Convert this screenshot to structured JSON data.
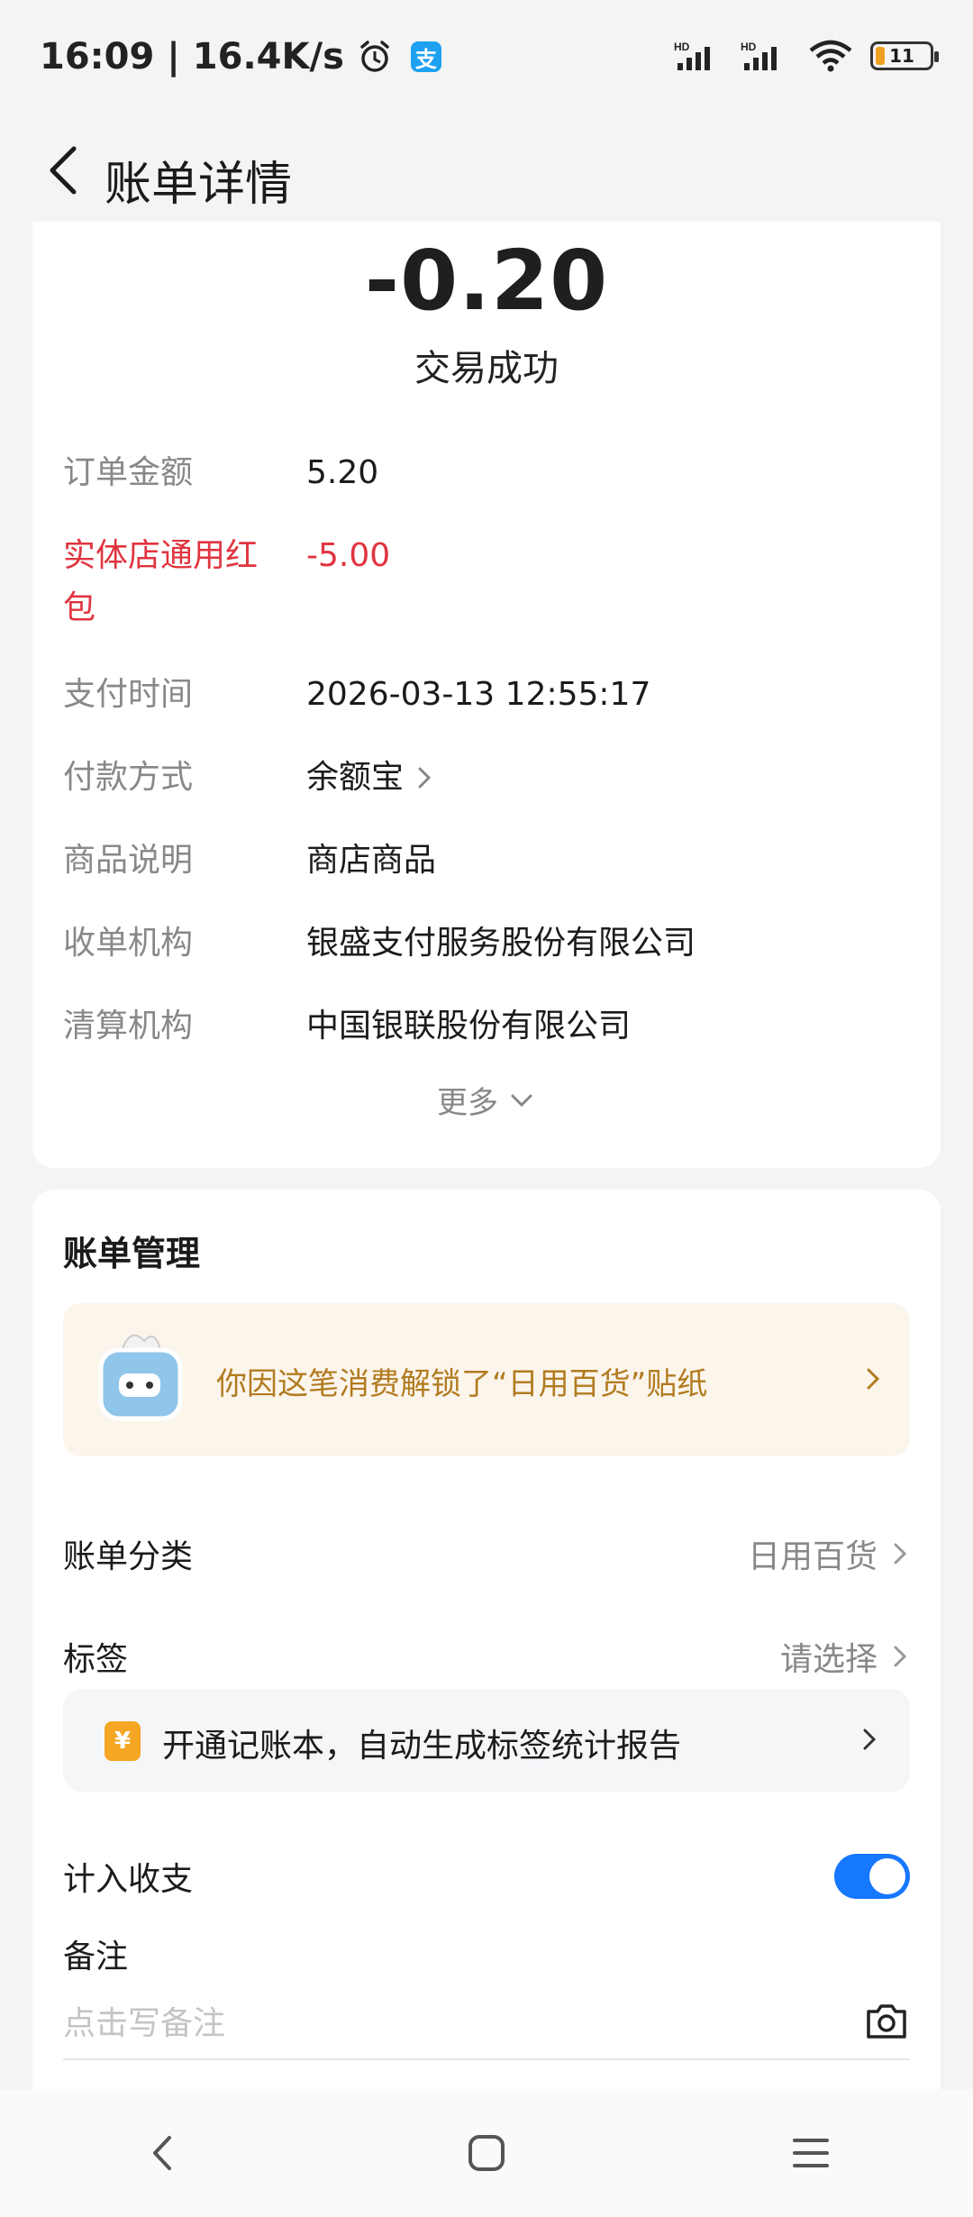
{
  "status_bar": {
    "time_speed": "16:09 | 16.4K/s",
    "alipay_icon_text": "支",
    "battery": "11",
    "icons": [
      "alarm-icon",
      "alipay-notification-icon",
      "signal-hd-icon",
      "signal-hd-icon",
      "wifi-icon",
      "battery-icon"
    ]
  },
  "header": {
    "title": "账单详情"
  },
  "summary": {
    "amount": "-0.20",
    "status": "交易成功",
    "rows": [
      {
        "label": "订单金额",
        "value": "5.20"
      },
      {
        "label": "实体店通用红包",
        "value": "-5.00",
        "accent": "#e0343f"
      },
      {
        "label": "支付时间",
        "value": "2026-03-13 12:55:17"
      },
      {
        "label": "付款方式",
        "value": "余额宝"
      },
      {
        "label": "商品说明",
        "value": "商店商品"
      },
      {
        "label": "收单机构",
        "value": "银盛支付服务股份有限公司"
      },
      {
        "label": "清算机构",
        "value": "中国银联股份有限公司"
      }
    ],
    "more": "更多"
  },
  "management": {
    "title": "账单管理",
    "sticker_text": "你因这笔消费解锁了“日用百货”贴纸",
    "category_label": "账单分类",
    "category_value": "日用百货",
    "tag_label": "标签",
    "tag_value": "请选择",
    "promo_icon": "¥",
    "promo_text": "开通记账本，自动生成标签统计报告",
    "income_label": "计入收支",
    "income_toggle": true,
    "note_label": "备注",
    "note_placeholder": "点击写备注"
  },
  "colors": {
    "accent_red": "#e0343f",
    "toggle_blue": "#1677ff",
    "sticker_text": "#b27b1f"
  }
}
